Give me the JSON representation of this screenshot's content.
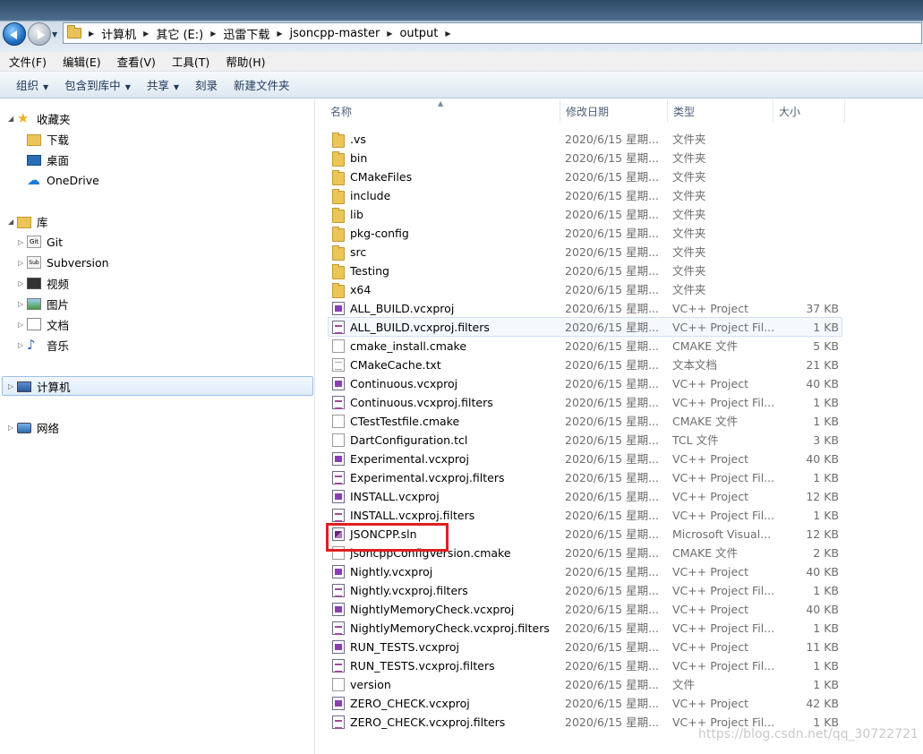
{
  "address": {
    "crumbs": [
      "计算机",
      "其它 (E:)",
      "迅雷下载",
      "jsoncpp-master",
      "output"
    ]
  },
  "menubar": [
    "文件(F)",
    "编辑(E)",
    "查看(V)",
    "工具(T)",
    "帮助(H)"
  ],
  "toolbar": {
    "organize": "组织",
    "include_in_library": "包含到库中",
    "share": "共享",
    "burn": "刻录",
    "new_folder": "新建文件夹"
  },
  "navpane": {
    "favorites": "收藏夹",
    "downloads": "下载",
    "desktop": "桌面",
    "onedrive": "OneDrive",
    "libraries": "库",
    "git": "Git",
    "subversion": "Subversion",
    "videos": "视频",
    "pictures": "图片",
    "documents": "文档",
    "music": "音乐",
    "computer": "计算机",
    "network": "网络"
  },
  "columns": {
    "name": "名称",
    "date": "修改日期",
    "type": "类型",
    "size": "大小"
  },
  "files": [
    {
      "name": ".vs",
      "date": "2020/6/15 星期...",
      "type": "文件夹",
      "size": "",
      "icon": "folder"
    },
    {
      "name": "bin",
      "date": "2020/6/15 星期...",
      "type": "文件夹",
      "size": "",
      "icon": "folder"
    },
    {
      "name": "CMakeFiles",
      "date": "2020/6/15 星期...",
      "type": "文件夹",
      "size": "",
      "icon": "folder"
    },
    {
      "name": "include",
      "date": "2020/6/15 星期...",
      "type": "文件夹",
      "size": "",
      "icon": "folder"
    },
    {
      "name": "lib",
      "date": "2020/6/15 星期...",
      "type": "文件夹",
      "size": "",
      "icon": "folder"
    },
    {
      "name": "pkg-config",
      "date": "2020/6/15 星期...",
      "type": "文件夹",
      "size": "",
      "icon": "folder"
    },
    {
      "name": "src",
      "date": "2020/6/15 星期...",
      "type": "文件夹",
      "size": "",
      "icon": "folder"
    },
    {
      "name": "Testing",
      "date": "2020/6/15 星期...",
      "type": "文件夹",
      "size": "",
      "icon": "folder"
    },
    {
      "name": "x64",
      "date": "2020/6/15 星期...",
      "type": "文件夹",
      "size": "",
      "icon": "folder"
    },
    {
      "name": "ALL_BUILD.vcxproj",
      "date": "2020/6/15 星期...",
      "type": "VC++ Project",
      "size": "37 KB",
      "icon": "proj"
    },
    {
      "name": "ALL_BUILD.vcxproj.filters",
      "date": "2020/6/15 星期...",
      "type": "VC++ Project Fil...",
      "size": "1 KB",
      "icon": "filt"
    },
    {
      "name": "cmake_install.cmake",
      "date": "2020/6/15 星期...",
      "type": "CMAKE 文件",
      "size": "5 KB",
      "icon": "doc"
    },
    {
      "name": "CMakeCache.txt",
      "date": "2020/6/15 星期...",
      "type": "文本文档",
      "size": "21 KB",
      "icon": "txt"
    },
    {
      "name": "Continuous.vcxproj",
      "date": "2020/6/15 星期...",
      "type": "VC++ Project",
      "size": "40 KB",
      "icon": "proj"
    },
    {
      "name": "Continuous.vcxproj.filters",
      "date": "2020/6/15 星期...",
      "type": "VC++ Project Fil...",
      "size": "1 KB",
      "icon": "filt"
    },
    {
      "name": "CTestTestfile.cmake",
      "date": "2020/6/15 星期...",
      "type": "CMAKE 文件",
      "size": "1 KB",
      "icon": "doc"
    },
    {
      "name": "DartConfiguration.tcl",
      "date": "2020/6/15 星期...",
      "type": "TCL 文件",
      "size": "3 KB",
      "icon": "doc"
    },
    {
      "name": "Experimental.vcxproj",
      "date": "2020/6/15 星期...",
      "type": "VC++ Project",
      "size": "40 KB",
      "icon": "proj"
    },
    {
      "name": "Experimental.vcxproj.filters",
      "date": "2020/6/15 星期...",
      "type": "VC++ Project Fil...",
      "size": "1 KB",
      "icon": "filt"
    },
    {
      "name": "INSTALL.vcxproj",
      "date": "2020/6/15 星期...",
      "type": "VC++ Project",
      "size": "12 KB",
      "icon": "proj"
    },
    {
      "name": "INSTALL.vcxproj.filters",
      "date": "2020/6/15 星期...",
      "type": "VC++ Project Fil...",
      "size": "1 KB",
      "icon": "filt"
    },
    {
      "name": "JSONCPP.sln",
      "date": "2020/6/15 星期...",
      "type": "Microsoft Visual...",
      "size": "12 KB",
      "icon": "sln"
    },
    {
      "name": "jsoncppConfigVersion.cmake",
      "date": "2020/6/15 星期...",
      "type": "CMAKE 文件",
      "size": "2 KB",
      "icon": "doc"
    },
    {
      "name": "Nightly.vcxproj",
      "date": "2020/6/15 星期...",
      "type": "VC++ Project",
      "size": "40 KB",
      "icon": "proj"
    },
    {
      "name": "Nightly.vcxproj.filters",
      "date": "2020/6/15 星期...",
      "type": "VC++ Project Fil...",
      "size": "1 KB",
      "icon": "filt"
    },
    {
      "name": "NightlyMemoryCheck.vcxproj",
      "date": "2020/6/15 星期...",
      "type": "VC++ Project",
      "size": "40 KB",
      "icon": "proj"
    },
    {
      "name": "NightlyMemoryCheck.vcxproj.filters",
      "date": "2020/6/15 星期...",
      "type": "VC++ Project Fil...",
      "size": "1 KB",
      "icon": "filt"
    },
    {
      "name": "RUN_TESTS.vcxproj",
      "date": "2020/6/15 星期...",
      "type": "VC++ Project",
      "size": "11 KB",
      "icon": "proj"
    },
    {
      "name": "RUN_TESTS.vcxproj.filters",
      "date": "2020/6/15 星期...",
      "type": "VC++ Project Fil...",
      "size": "1 KB",
      "icon": "filt"
    },
    {
      "name": "version",
      "date": "2020/6/15 星期...",
      "type": "文件",
      "size": "1 KB",
      "icon": "doc"
    },
    {
      "name": "ZERO_CHECK.vcxproj",
      "date": "2020/6/15 星期...",
      "type": "VC++ Project",
      "size": "42 KB",
      "icon": "proj"
    },
    {
      "name": "ZERO_CHECK.vcxproj.filters",
      "date": "2020/6/15 星期...",
      "type": "VC++ Project Fil...",
      "size": "1 KB",
      "icon": "filt"
    }
  ],
  "watermark": "https://blog.csdn.net/qq_30722721"
}
